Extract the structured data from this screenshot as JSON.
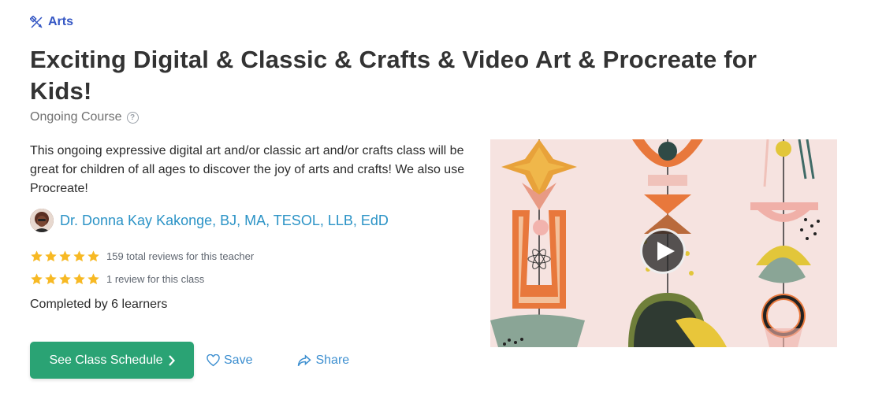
{
  "category": {
    "label": "Arts",
    "icon": "pencil-ruler-icon",
    "color": "#3557c4"
  },
  "title": "Exciting Digital & Classic & Crafts & Video Art & Procreate for Kids!",
  "course_type": {
    "label": "Ongoing Course",
    "help_icon": "question-circle-icon"
  },
  "description": "This ongoing expressive digital art and/or classic art and/or crafts class will be great for children of all ages to discover the joy of arts and crafts! We also use Procreate!",
  "teacher": {
    "name": "Dr. Donna Kay Kakonge, BJ, MA, TESOL, LLB, EdD",
    "avatar": "teacher-avatar",
    "color": "#2b93c6"
  },
  "ratings": [
    {
      "stars": 5,
      "text": "159 total reviews for this teacher"
    },
    {
      "stars": 5,
      "text": "1 review for this class"
    }
  ],
  "completed": "Completed by 6 learners",
  "actions": {
    "primary_label": "See Class Schedule",
    "primary_icon": "chevron-right-icon",
    "primary_color": "#2aa374",
    "save_label": "Save",
    "save_icon": "heart-icon",
    "share_label": "Share",
    "share_icon": "share-arrow-icon",
    "link_color": "#3d8fd0"
  },
  "media": {
    "type": "video-thumbnail",
    "play_icon": "play-icon"
  }
}
